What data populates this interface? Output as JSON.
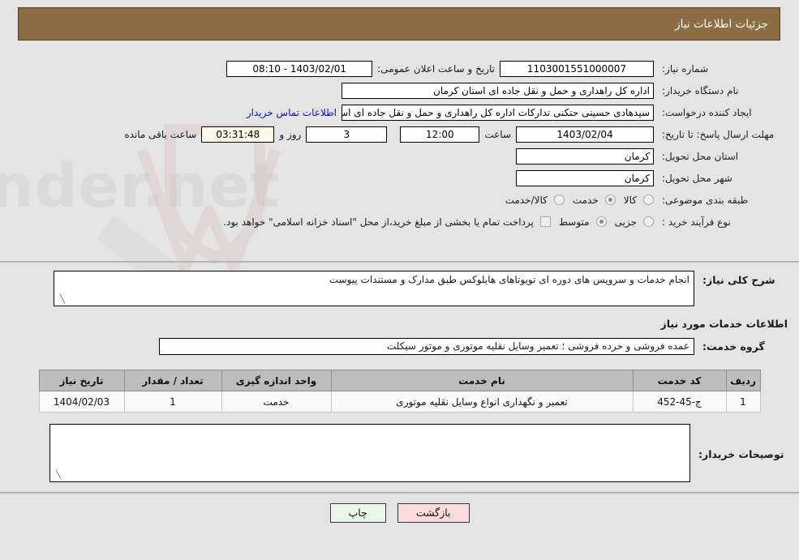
{
  "header": {
    "title": "جزئیات اطلاعات نیاز",
    "bar_color": "#8d6e42"
  },
  "top_form": {
    "need_number_label": "شماره نیاز:",
    "need_number_value": "1103001551000007",
    "public_announce_label": "تاریخ و ساعت اعلان عمومی:",
    "public_announce_value": "1403/02/01 - 08:10",
    "buyer_org_label": "نام دستگاه خریدار:",
    "buyer_org_value": "اداره کل راهداری و حمل و نقل جاده ای استان کرمان",
    "creator_label": "ایجاد کننده درخواست:",
    "creator_value": "سیدهادی حسینی حتکنی تدارکات اداره کل راهداری و حمل و نقل جاده ای است",
    "contact_link": "اطلاعات تماس خریدار",
    "deadline_label": "مهلت ارسال پاسخ: تا تاریخ:",
    "deadline_date": "1403/02/04",
    "hour_label": "ساعت",
    "deadline_time": "12:00",
    "days_value": "3",
    "days_label": "روز و",
    "countdown_value": "03:31:48",
    "countdown_label": "ساعت باقی مانده",
    "province_label": "استان محل تحویل:",
    "province_value": "کرمان",
    "city_label": "شهر محل تحویل:",
    "city_value": "کرمان",
    "category_label": "طبقه بندی موضوعی:",
    "category_options": [
      {
        "label": "کالا",
        "selected": false
      },
      {
        "label": "خدمت",
        "selected": true
      },
      {
        "label": "کالا/خدمت",
        "selected": false
      }
    ],
    "process_label": "نوع فرآیند خرید :",
    "process_options": [
      {
        "label": "جزیی",
        "selected": false
      },
      {
        "label": "متوسط",
        "selected": true
      }
    ],
    "treasury_checkbox_checked": false,
    "treasury_note": "پرداخت تمام یا بخشی از مبلغ خرید،از محل \"اسناد خزانه اسلامی\" خواهد بود."
  },
  "description": {
    "label": "شرح کلی نیاز:",
    "value": "انجام خدمات و سرویس های دوره ای تویوتاهای هایلوکس طبق مدارک و مستندات پیوست"
  },
  "services": {
    "subheading": "اطلاعات خدمات مورد نیاز",
    "group_label": "گروه خدمت:",
    "group_value": "عمده فروشی و خرده فروشی ؛ تعمیر وسایل نقلیه موتوری و موتور سیکلت",
    "table": {
      "headers": [
        "ردیف",
        "کد خدمت",
        "نام خدمت",
        "واحد اندازه گیری",
        "تعداد / مقدار",
        "تاریخ نیاز"
      ],
      "rows": [
        {
          "row": "1",
          "code": "ج-45-452",
          "name": "تعمیر و نگهداری انواع وسایل نقلیه موتوری",
          "unit": "خدمت",
          "qty": "1",
          "date": "1404/02/03"
        }
      ]
    }
  },
  "buyer_notes": {
    "label": "توصیحات خریدار:",
    "value": ""
  },
  "footer": {
    "back_label": "بازگشت",
    "print_label": "چاپ"
  },
  "watermark": {
    "text": "AriaTender.net"
  }
}
